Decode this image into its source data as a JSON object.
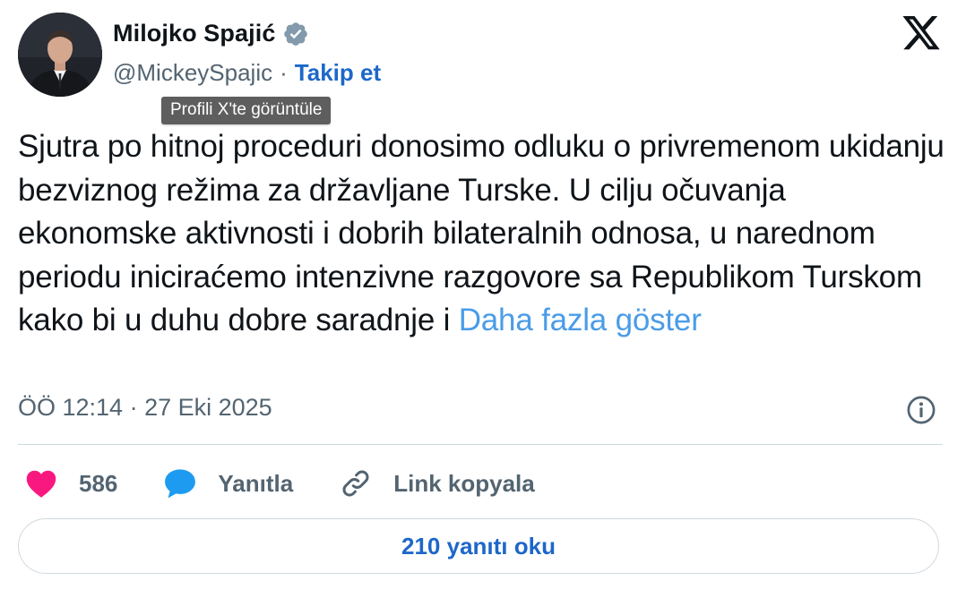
{
  "author": {
    "name": "Milojko Spajić",
    "handle": "@MickeySpajic",
    "separator": "·",
    "follow_label": "Takip et"
  },
  "tooltip": "Profili X'te görüntüle",
  "tweet": {
    "text": "Sjutra po hitnoj proceduri donosimo odluku o privremenom ukidanju bezviznog režima za državljane Turske. U cilju očuvanja ekonomske aktivnosti i dobrih bilateralnih odnosa, u narednom periodu iniciraćemo intenzivne razgovore sa Republikom Turskom kako bi u duhu dobre saradnje i ",
    "show_more": "Daha fazla göster",
    "timestamp": "ÖÖ 12:14 · 27 Eki 2025"
  },
  "actions": {
    "like_count": "586",
    "reply_label": "Yanıtla",
    "copy_link_label": "Link kopyala"
  },
  "replies_button": "210 yanıtı oku",
  "icons": {
    "verified": "verified-badge-icon",
    "logo": "x-logo-icon",
    "info": "info-icon",
    "like": "heart-icon",
    "reply": "speech-bubble-icon",
    "link": "link-icon"
  },
  "colors": {
    "accent": "#1d67c9",
    "link": "#4a9ce8",
    "like": "#f91880",
    "reply": "#1d9bf0",
    "muted": "#536471",
    "verified": "#829aab"
  }
}
